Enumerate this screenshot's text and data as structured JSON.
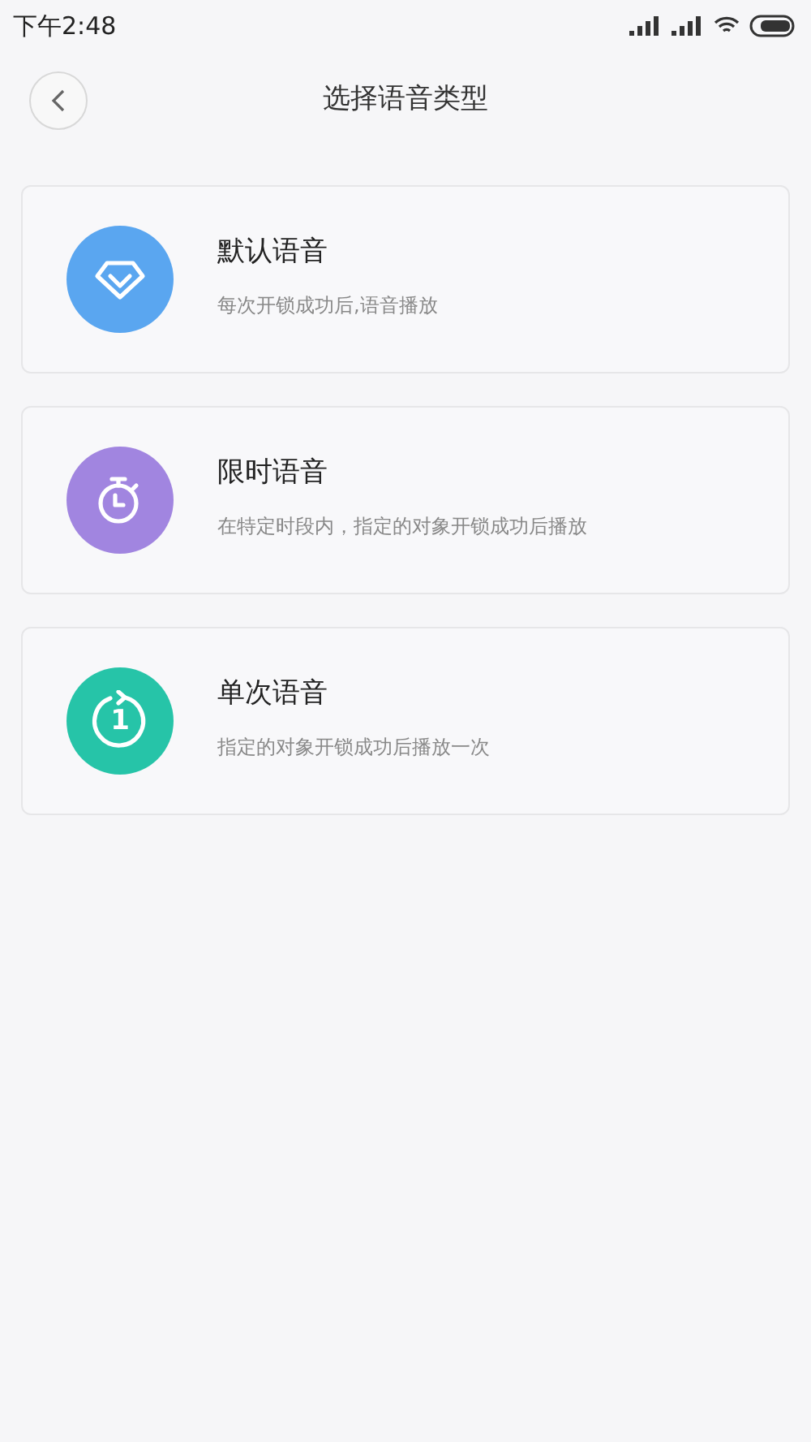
{
  "status_bar": {
    "time": "下午2:48"
  },
  "header": {
    "title": "选择语音类型"
  },
  "options": [
    {
      "kind": "diamond",
      "color": "#5aa6f0",
      "title": "默认语音",
      "description": "每次开锁成功后,语音播放"
    },
    {
      "kind": "timer",
      "color": "#a185e0",
      "title": "限时语音",
      "description": "在特定时段内，指定的对象开锁成功后播放"
    },
    {
      "kind": "once",
      "color": "#26c4a8",
      "icon_label": "1",
      "title": "单次语音",
      "description": "指定的对象开锁成功后播放一次"
    }
  ]
}
